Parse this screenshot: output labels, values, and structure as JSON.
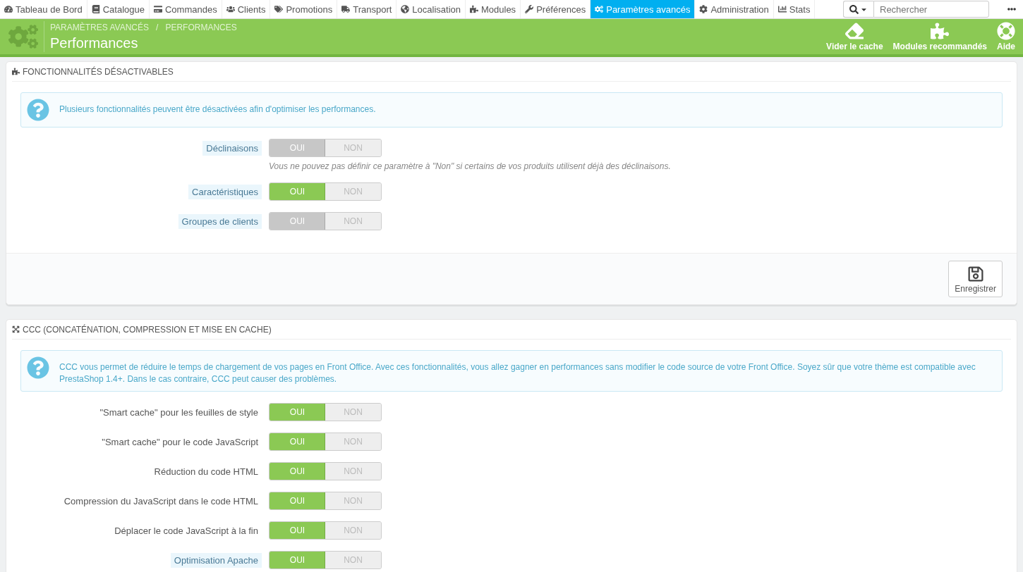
{
  "nav": {
    "items": [
      {
        "label": "Tableau de Bord",
        "selected": false
      },
      {
        "label": "Catalogue",
        "selected": false
      },
      {
        "label": "Commandes",
        "selected": false
      },
      {
        "label": "Clients",
        "selected": false
      },
      {
        "label": "Promotions",
        "selected": false
      },
      {
        "label": "Transport",
        "selected": false
      },
      {
        "label": "Localisation",
        "selected": false
      },
      {
        "label": "Modules",
        "selected": false
      },
      {
        "label": "Préférences",
        "selected": false
      },
      {
        "label": "Paramètres avancés",
        "selected": true
      },
      {
        "label": "Administration",
        "selected": false
      },
      {
        "label": "Stats",
        "selected": false
      }
    ],
    "search": {
      "placeholder": "Rechercher"
    }
  },
  "header": {
    "breadcrumb": [
      "PARAMÈTRES AVANCÉS",
      "PERFORMANCES"
    ],
    "separator": "/",
    "title": "Performances",
    "actions": [
      {
        "label": "Vider le cache"
      },
      {
        "label": "Modules recommandés"
      },
      {
        "label": "Aide"
      }
    ]
  },
  "panels": [
    {
      "title": "FONCTIONNALITÉS DÉSACTIVABLES",
      "info": "Plusieurs fonctionnalités peuvent être désactivées afin d'optimiser les performances.",
      "fields": [
        {
          "label": "Déclinaisons",
          "hint": true,
          "on": true,
          "disabled": true,
          "yes": "OUI",
          "no": "NON",
          "help": "Vous ne pouvez pas définir ce paramètre à \"Non\" si certains de vos produits utilisent déjà des déclinaisons."
        },
        {
          "label": "Caractéristiques",
          "hint": true,
          "on": true,
          "disabled": false,
          "yes": "OUI",
          "no": "NON"
        },
        {
          "label": "Groupes de clients",
          "hint": true,
          "on": true,
          "disabled": true,
          "yes": "OUI",
          "no": "NON"
        }
      ],
      "save": "Enregistrer"
    },
    {
      "title": "CCC (CONCATÉNATION, COMPRESSION ET MISE EN CACHE)",
      "info": "CCC vous permet de réduire le temps de chargement de vos pages en Front Office. Avec ces fonctionnalités, vous allez gagner en performances sans modifier le code source de votre Front Office. Soyez sûr que votre thème est compatible avec PrestaShop 1.4+. Dans le cas contraire, CCC peut causer des problèmes.",
      "fields": [
        {
          "label": "\"Smart cache\" pour les feuilles de style",
          "hint": false,
          "on": true,
          "disabled": false,
          "yes": "OUI",
          "no": "NON"
        },
        {
          "label": "\"Smart cache\" pour le code JavaScript",
          "hint": false,
          "on": true,
          "disabled": false,
          "yes": "OUI",
          "no": "NON"
        },
        {
          "label": "Réduction du code HTML",
          "hint": false,
          "on": true,
          "disabled": false,
          "yes": "OUI",
          "no": "NON"
        },
        {
          "label": "Compression du JavaScript dans le code HTML",
          "hint": false,
          "on": true,
          "disabled": false,
          "yes": "OUI",
          "no": "NON"
        },
        {
          "label": "Déplacer le code JavaScript à la fin",
          "hint": false,
          "on": true,
          "disabled": false,
          "yes": "OUI",
          "no": "NON"
        },
        {
          "label": "Optimisation Apache",
          "hint": true,
          "on": true,
          "disabled": false,
          "yes": "OUI",
          "no": "NON"
        }
      ]
    }
  ]
}
